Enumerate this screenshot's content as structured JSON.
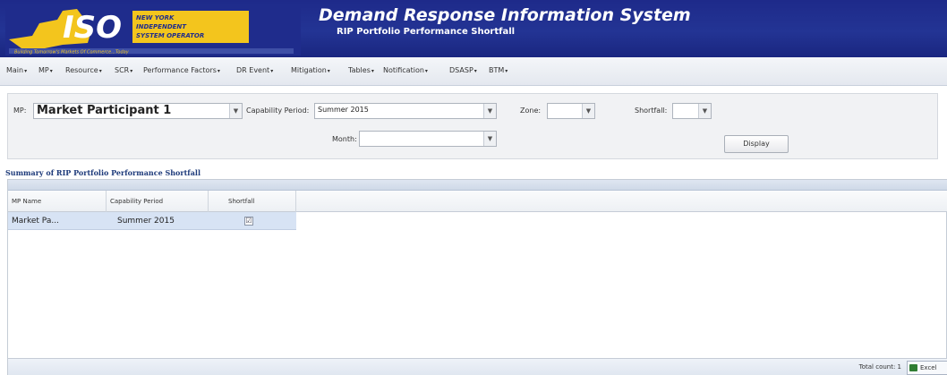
{
  "header": {
    "title": "Demand Response Information System",
    "subtitle": "RIP Portfolio Performance Shortfall",
    "logo": {
      "letters": "ISO",
      "org_line1": "NEW YORK",
      "org_line2": "INDEPENDENT",
      "org_line3": "SYSTEM OPERATOR",
      "tagline": "Building Tomorrow's Markets Of Commerce...Today"
    }
  },
  "menu": [
    {
      "label": "Main"
    },
    {
      "label": "MP"
    },
    {
      "label": "Resource"
    },
    {
      "label": "SCR"
    },
    {
      "label": "Performance Factors"
    },
    {
      "label": "DR Event"
    },
    {
      "label": "Mitigation"
    },
    {
      "label": "Tables"
    },
    {
      "label": "Notification"
    },
    {
      "label": "DSASP"
    },
    {
      "label": "BTM"
    }
  ],
  "filters": {
    "mp_label": "MP:",
    "mp_value": "Market Participant 1",
    "capability_label": "Capability Period:",
    "capability_value": "Summer 2015",
    "zone_label": "Zone:",
    "zone_value": "",
    "shortfall_label": "Shortfall:",
    "shortfall_value": "",
    "month_label": "Month:",
    "month_value": "",
    "display_button": "Display"
  },
  "grid": {
    "title": "Summary of RIP Portfolio Performance Shortfall",
    "columns": [
      "MP Name",
      "Capability Period",
      "Shortfall"
    ],
    "rows": [
      {
        "mp_name": "Market Pa...",
        "capability_period": "Summer 2015",
        "shortfall": "☑"
      }
    ],
    "total_count": "Total count: 1",
    "excel_button": "Excel"
  },
  "colors": {
    "header_bg": "#233494",
    "row_selected": "#d7e3f4",
    "grid_title": "#1d3a7a"
  }
}
